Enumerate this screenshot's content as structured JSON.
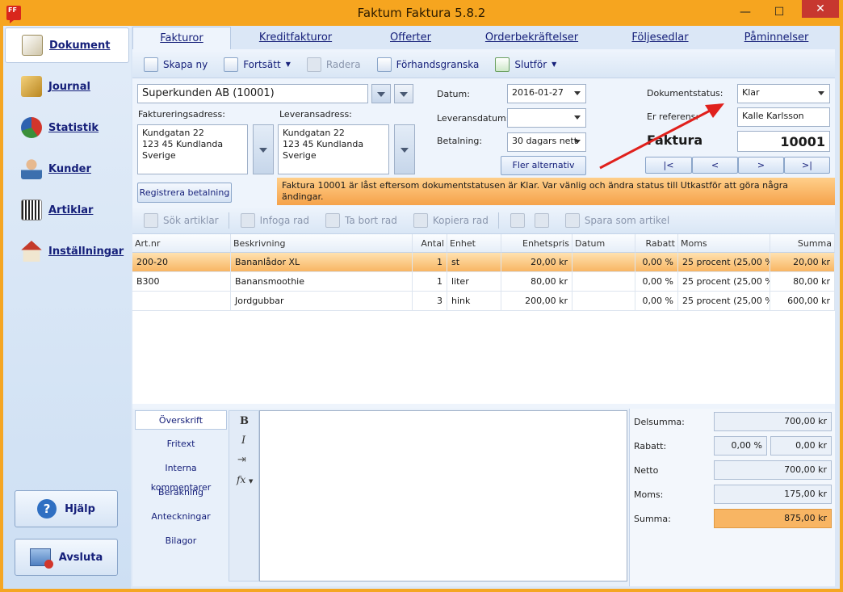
{
  "window": {
    "title": "Faktum Faktura 5.8.2",
    "icon_text": "FF"
  },
  "sidebar": {
    "items": [
      {
        "label": "Dokument",
        "icon": "document-icon",
        "color": "#7a6a40"
      },
      {
        "label": "Journal",
        "icon": "folder-icon",
        "color": "#c99a2e"
      },
      {
        "label": "Statistik",
        "icon": "pie-chart-icon",
        "color": "#d2362b"
      },
      {
        "label": "Kunder",
        "icon": "person-icon",
        "color": "#3c6fae"
      },
      {
        "label": "Artiklar",
        "icon": "barcode-icon",
        "color": "#333"
      },
      {
        "label": "Inställningar",
        "icon": "house-icon",
        "color": "#c43a2a"
      }
    ],
    "help_label": "Hjälp",
    "exit_label": "Avsluta"
  },
  "tabs": [
    {
      "label": "Fakturor"
    },
    {
      "label": "Kreditfakturor"
    },
    {
      "label": "Offerter"
    },
    {
      "label": "Orderbekräftelser"
    },
    {
      "label": "Följesedlar"
    },
    {
      "label": "Påminnelser"
    }
  ],
  "toolbar": {
    "new_label": "Skapa ny",
    "continue_label": "Fortsätt",
    "delete_label": "Radera",
    "preview_label": "Förhandsgranska",
    "finish_label": "Slutför"
  },
  "form": {
    "customer": "Superkunden AB (10001)",
    "billing_label": "Faktureringsadress:",
    "billing_address": "Kundgatan 22\n123 45 Kundlanda\nSverige",
    "delivery_label": "Leveransadress:",
    "delivery_address": "Kundgatan 22\n123 45 Kundlanda\nSverige",
    "register_payment": "Registrera betalning",
    "date_label": "Datum:",
    "date_value": "2016-01-27",
    "delivery_date_label": "Leveransdatum:",
    "delivery_date_value": "",
    "payment_label": "Betalning:",
    "payment_value": "30 dagars nett",
    "more_options": "Fler alternativ",
    "status_label": "Dokumentstatus:",
    "status_value": "Klar",
    "reference_label": "Er referens:",
    "reference_value": "Kalle Karlsson",
    "doc_type": "Faktura",
    "doc_number": "10001",
    "nav_first": "|<",
    "nav_prev": "<",
    "nav_next": ">",
    "nav_last": ">|",
    "warning": "Faktura 10001 är låst eftersom dokumentstatusen är Klar. Var vänlig och ändra status till Utkastför att göra några ändingar."
  },
  "rows_toolbar": {
    "search_label": "Sök artiklar",
    "insert_label": "Infoga rad",
    "remove_label": "Ta bort rad",
    "copy_label": "Kopiera rad",
    "save_label": "Spara som artikel"
  },
  "grid": {
    "columns": [
      "Art.nr",
      "Beskrivning",
      "Antal",
      "Enhet",
      "Enhetspris",
      "Datum",
      "Rabatt",
      "Moms",
      "Summa"
    ],
    "rows": [
      {
        "artnr": "200-20",
        "desc": "Bananlådor XL",
        "qty": "1",
        "unit": "st",
        "price": "20,00 kr",
        "date": "",
        "discount": "0,00 %",
        "vat": "25 procent (25,00 %)",
        "sum": "20,00 kr"
      },
      {
        "artnr": "B300",
        "desc": "Banansmoothie",
        "qty": "1",
        "unit": "liter",
        "price": "80,00 kr",
        "date": "",
        "discount": "0,00 %",
        "vat": "25 procent (25,00 %)",
        "sum": "80,00 kr"
      },
      {
        "artnr": "",
        "desc": "Jordgubbar",
        "qty": "3",
        "unit": "hink",
        "price": "200,00 kr",
        "date": "",
        "discount": "0,00 %",
        "vat": "25 procent (25,00 %)",
        "sum": "600,00 kr"
      }
    ]
  },
  "bottom": {
    "nav": [
      "Överskrift",
      "Fritext",
      "Interna kommentarer",
      "Beräkning",
      "Anteckningar",
      "Bilagor"
    ],
    "format": {
      "bold": "B",
      "italic": "I",
      "fx": "fx"
    }
  },
  "summary": {
    "subtotal_label": "Delsumma:",
    "subtotal": "700,00 kr",
    "discount_label": "Rabatt:",
    "discount_pct": "0,00 %",
    "discount_amt": "0,00 kr",
    "net_label": "Netto",
    "net": "700,00 kr",
    "vat_label": "Moms:",
    "vat": "175,00 kr",
    "total_label": "Summa:",
    "total": "875,00 kr"
  }
}
